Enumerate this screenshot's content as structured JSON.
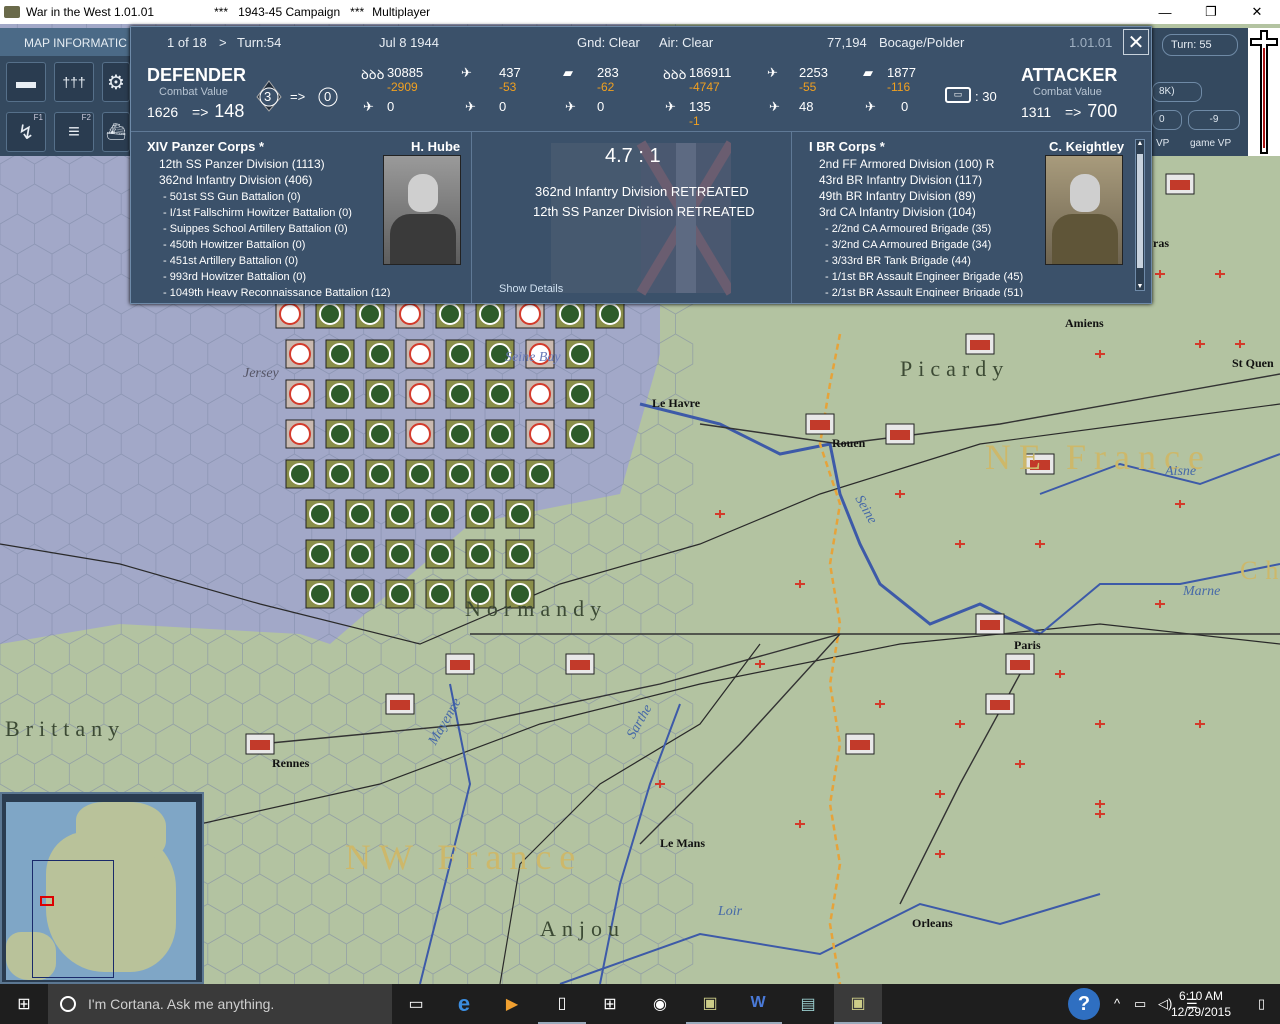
{
  "window": {
    "app_title": "War in the West 1.01.01",
    "campaign": "***   1943-45 Campaign   ***",
    "mode": "Multiplayer",
    "minimize": "—",
    "maximize": "❐",
    "close": "✕"
  },
  "left_panel": {
    "map_info": "MAP INFORMATIC",
    "tools": [
      {
        "icon": "ground-units-icon",
        "glyph": "▬",
        "fkey": ""
      },
      {
        "icon": "formation-icon",
        "glyph": "†††",
        "fkey": ""
      },
      {
        "icon": "gear-icon",
        "glyph": "⚙",
        "fkey": ""
      },
      {
        "icon": "move-arrow-icon",
        "glyph": "↯",
        "fkey": "F1"
      },
      {
        "icon": "rail-icon",
        "glyph": "≡",
        "fkey": "F2"
      },
      {
        "icon": "naval-icon",
        "glyph": "⛴",
        "fkey": ""
      }
    ]
  },
  "right_panel": {
    "turn": "Turn: 55",
    "value_8k": "8K)",
    "box_0": "0",
    "box_neg9": "-9",
    "vp": "VP",
    "game_vp": "game VP"
  },
  "combat": {
    "page": "1 of 18",
    "next": ">",
    "turn": "Turn:54",
    "date": "Jul 8 1944",
    "ground": "Gnd: Clear",
    "air": "Air: Clear",
    "terrain_count": "77,194",
    "terrain": "Bocage/Polder",
    "version": "1.01.01",
    "close": "✕",
    "defender": {
      "title": "DEFENDER",
      "cv_label": "Combat Value",
      "cv_from": "1626",
      "cv_arrow": "=>",
      "cv_to": "148",
      "fort_from": "3",
      "fort_arrow": "=>",
      "fort_to": "0",
      "men": "30885",
      "men_loss": "-2909",
      "planes": "437",
      "planes_loss": "-53",
      "tanks": "283",
      "tanks_loss": "-62",
      "guns": "0",
      "aircraft2": "0",
      "aircraft3": "0"
    },
    "attacker": {
      "title": "ATTACKER",
      "cv_label": "Combat Value",
      "cv_from": "1311",
      "cv_arrow": "=>",
      "cv_to": "700",
      "men": "186911",
      "men_loss": "-4747",
      "planes": "2253",
      "planes_loss": "-55",
      "tanks": "1877",
      "tanks_loss": "-116",
      "guns": "135",
      "guns_loss": "-1",
      "aircraft2": "48",
      "aircraft3": "0",
      "support": ": 30"
    },
    "ratio": "4.7 : 1",
    "results": [
      "362nd Infantry Division RETREATED",
      "12th SS Panzer Division RETREATED"
    ],
    "show_details": "Show Details",
    "def_corps": "XIV Panzer Corps *",
    "def_cmdr": "H. Hube",
    "def_units": [
      "12th SS Panzer Division (1113)",
      "362nd Infantry Division (406)"
    ],
    "def_subunits": [
      "- 501st SS Gun Battalion (0)",
      "- I/1st Fallschirm Howitzer Battalion (0)",
      "- Suippes School Artillery Battalion (0)",
      "- 450th Howitzer Battalion (0)",
      "- 451st Artillery Battalion (0)",
      "- 993rd Howitzer Battalion (0)",
      "- 1049th Heavy Reconnaissance Battalion (12)"
    ],
    "att_corps": "I BR Corps *",
    "att_cmdr": "C. Keightley",
    "att_units": [
      "2nd FF Armored Division (100) R",
      "43rd BR Infantry Division (117)",
      "49th BR Infantry Division (89)",
      "3rd CA Infantry Division (104)"
    ],
    "att_subunits": [
      "- 2/2nd CA Armoured Brigade (35)",
      "- 3/2nd CA Armoured Brigade (34)",
      "- 3/33rd BR Tank Brigade (44)",
      "- 1/1st BR Assault Engineer Brigade (45)",
      "- 2/1st BR Assault Engineer Brigade (51)"
    ]
  },
  "map_labels": {
    "picardy": "Picardy",
    "ne_france": "NE France",
    "normandy": "Normandy",
    "brittany": "Brittany",
    "nw_france": "NW France",
    "anjou": "Anjou",
    "champagne": "Ch",
    "seine_bay": "Seine Bay",
    "jersey": "Jersey",
    "le_havre": "Le Havre",
    "rouen": "Rouen",
    "amiens": "Amiens",
    "st_quentin": "St Quen",
    "aras": "ras",
    "paris": "Paris",
    "rennes": "Rennes",
    "le_mans": "Le Mans",
    "orleans": "Orleans",
    "seine": "Seine",
    "aisne": "Aisne",
    "marne": "Marne",
    "loir": "Loir",
    "mayenne": "Mayenne",
    "sarthe": "Sarthe"
  },
  "taskbar": {
    "start": "⊞",
    "search": "I'm Cortana. Ask me anything.",
    "time": "6:10 AM",
    "date": "12/29/2015",
    "help": "?"
  },
  "colors": {
    "panel": "#3b516a",
    "loss": "#f0a020",
    "map_land": "#b3c3a1",
    "map_water": "#9aa2c4",
    "allied_red": "#d43a2a"
  }
}
